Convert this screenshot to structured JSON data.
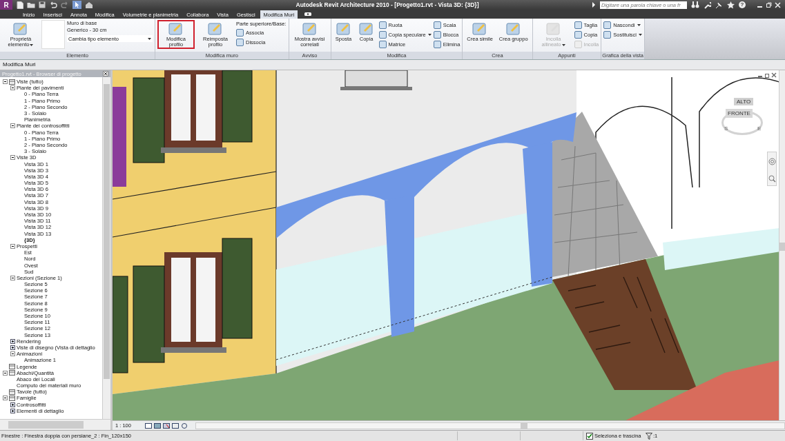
{
  "title_bar": {
    "logo": "R",
    "title": "Autodesk Revit Architecture 2010 - [Progetto1.rvt - Vista 3D: {3D}]",
    "search": {
      "placeholder": "Digitare una parola chiave o una fr"
    },
    "help": "?"
  },
  "tabs": [
    {
      "label": "Inizio",
      "selected": false
    },
    {
      "label": "Inserisci",
      "selected": false
    },
    {
      "label": "Annota",
      "selected": false
    },
    {
      "label": "Modifica",
      "selected": false
    },
    {
      "label": "Volumetrie e planimetria",
      "selected": false
    },
    {
      "label": "Collabora",
      "selected": false
    },
    {
      "label": "Vista",
      "selected": false
    },
    {
      "label": "Gestisci",
      "selected": false
    },
    {
      "label": "Modifica Muri",
      "selected": true
    }
  ],
  "ribbon": {
    "panels": [
      {
        "label": "Elemento",
        "columns": [
          {
            "kind": "large",
            "label": "Proprietà elemento",
            "dropdown": true,
            "disabled": false,
            "highlighted": false
          },
          {
            "kind": "typeselector",
            "family": "Muro di base",
            "type": "Generico - 30 cm",
            "selector": "Cambia tipo elemento"
          }
        ]
      },
      {
        "label": "Modifica muro",
        "columns": [
          {
            "kind": "large",
            "label": "Modifica profilo",
            "dropdown": false,
            "disabled": false,
            "highlighted": true
          },
          {
            "kind": "large",
            "label": "Reimposta profilo",
            "dropdown": false,
            "disabled": false,
            "highlighted": false
          },
          {
            "kind": "stack",
            "heading": "Parte superiore/Base:",
            "items": [
              {
                "label": "Associa",
                "dropdown": false,
                "disabled": false
              },
              {
                "label": "Dissocia",
                "dropdown": false,
                "disabled": false
              }
            ]
          }
        ]
      },
      {
        "label": "Avviso",
        "columns": [
          {
            "kind": "large",
            "label": "Mostra avvisi correlati",
            "dropdown": false,
            "disabled": false,
            "highlighted": false
          }
        ]
      },
      {
        "label": "Modifica",
        "columns": [
          {
            "kind": "large",
            "label": "Sposta",
            "dropdown": false,
            "disabled": false,
            "highlighted": false
          },
          {
            "kind": "large",
            "label": "Copia",
            "dropdown": false,
            "disabled": false,
            "highlighted": false
          },
          {
            "kind": "stack",
            "items": [
              {
                "label": "Ruota",
                "dropdown": false,
                "disabled": false
              },
              {
                "label": "Copia speculare",
                "dropdown": true,
                "disabled": false
              },
              {
                "label": "Matrice",
                "dropdown": false,
                "disabled": false
              }
            ]
          },
          {
            "kind": "stack",
            "items": [
              {
                "label": "Scala",
                "dropdown": false,
                "disabled": false
              },
              {
                "label": "Blocca",
                "dropdown": false,
                "disabled": false
              },
              {
                "label": "Elimina",
                "dropdown": false,
                "disabled": false
              }
            ]
          }
        ]
      },
      {
        "label": "Crea",
        "columns": [
          {
            "kind": "large",
            "label": "Crea simile",
            "dropdown": false,
            "disabled": false,
            "highlighted": false
          },
          {
            "kind": "large",
            "label": "Crea gruppo",
            "dropdown": false,
            "disabled": false,
            "highlighted": false
          }
        ]
      },
      {
        "label": "Appunti",
        "columns": [
          {
            "kind": "large",
            "label": "Incolla allineato",
            "dropdown": true,
            "disabled": true,
            "highlighted": false
          },
          {
            "kind": "stack",
            "items": [
              {
                "label": "Taglia",
                "dropdown": false,
                "disabled": false
              },
              {
                "label": "Copia",
                "dropdown": false,
                "disabled": false
              },
              {
                "label": "Incolla",
                "dropdown": false,
                "disabled": true
              }
            ]
          }
        ]
      },
      {
        "label": "Grafica della vista",
        "columns": [
          {
            "kind": "stack",
            "items": [
              {
                "label": "Nascondi",
                "dropdown": true,
                "disabled": false
              },
              {
                "label": "Sostituisci",
                "dropdown": true,
                "disabled": false
              }
            ]
          }
        ]
      }
    ]
  },
  "options_bar": {
    "label": "Modifica Muri"
  },
  "browser": {
    "title": "Progetto1.rvt - Browser di progetto",
    "items": [
      {
        "label": "Viste (tutto)",
        "expanded": true,
        "children": [
          {
            "label": "Piante dei pavimenti",
            "expanded": true,
            "children": [
              {
                "label": "0 - Piano Terra"
              },
              {
                "label": "1 - Piano Primo"
              },
              {
                "label": "2 - Piano Secondo"
              },
              {
                "label": "3 - Solaio"
              },
              {
                "label": "Planimetria"
              }
            ]
          },
          {
            "label": "Piante dei controsoffitti",
            "expanded": true,
            "children": [
              {
                "label": "0 - Piano Terra"
              },
              {
                "label": "1 - Piano Primo"
              },
              {
                "label": "2 - Piano Secondo"
              },
              {
                "label": "3 - Solaio"
              }
            ]
          },
          {
            "label": "Viste 3D",
            "expanded": true,
            "children": [
              {
                "label": "Vista 3D 1",
                "active": false
              },
              {
                "label": "Vista 3D 3",
                "active": false
              },
              {
                "label": "Vista 3D 4",
                "active": false
              },
              {
                "label": "Vista 3D 5",
                "active": false
              },
              {
                "label": "Vista 3D 6",
                "active": false
              },
              {
                "label": "Vista 3D 7",
                "active": false
              },
              {
                "label": "Vista 3D 8",
                "active": false
              },
              {
                "label": "Vista 3D 9",
                "active": false
              },
              {
                "label": "Vista 3D 10",
                "active": false
              },
              {
                "label": "Vista 3D 11",
                "active": false
              },
              {
                "label": "Vista 3D 12",
                "active": false
              },
              {
                "label": "Vista 3D 13",
                "active": false
              },
              {
                "label": "{3D}",
                "active": true
              }
            ]
          },
          {
            "label": "Prospetti",
            "expanded": true,
            "children": [
              {
                "label": "Est"
              },
              {
                "label": "Nord"
              },
              {
                "label": "Ovest"
              },
              {
                "label": "Sud"
              }
            ]
          },
          {
            "label": "Sezioni (Sezione 1)",
            "expanded": true,
            "children": [
              {
                "label": "Sezione 5"
              },
              {
                "label": "Sezione 6"
              },
              {
                "label": "Sezione 7"
              },
              {
                "label": "Sezione 8"
              },
              {
                "label": "Sezione 9"
              },
              {
                "label": "Sezione 10"
              },
              {
                "label": "Sezione 11"
              },
              {
                "label": "Sezione 12"
              },
              {
                "label": "Sezione 13"
              }
            ]
          },
          {
            "label": "Rendering",
            "expanded": false
          },
          {
            "label": "Viste di disegno (Vista di dettaglio",
            "expanded": false
          },
          {
            "label": "Animazioni",
            "expanded": true,
            "children": [
              {
                "label": "Animazione 1"
              }
            ]
          }
        ]
      },
      {
        "label": "Legende"
      },
      {
        "label": "Abachi/Quantità",
        "expanded": true,
        "children": [
          {
            "label": "Abaco dei Locali"
          },
          {
            "label": "Computo dei materiali muro"
          }
        ]
      },
      {
        "label": "Tavole (tutto)"
      },
      {
        "label": "Famiglie",
        "expanded": true,
        "children": [
          {
            "label": "Controsoffitti",
            "expanded": false
          },
          {
            "label": "Elementi di dettaglio",
            "expanded": false
          }
        ]
      }
    ]
  },
  "viewport": {
    "viewcube": {
      "top": "ALTO",
      "front": "FRONTE",
      "compass": [
        "S",
        "E"
      ]
    },
    "scale": "1 : 100"
  },
  "status_bar": {
    "text": "Finestre : Finestra doppia con persiane_2 : Fin_120x150",
    "select_drag": {
      "label": "Seleziona e trascina",
      "checked": true
    },
    "filter": ":1"
  }
}
